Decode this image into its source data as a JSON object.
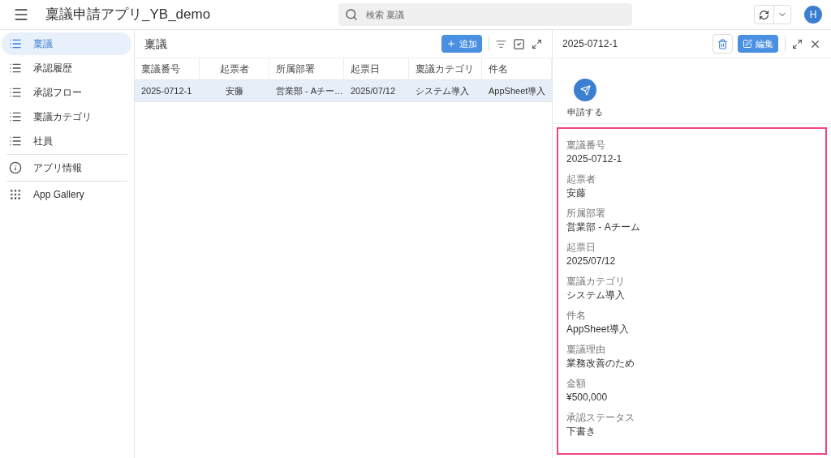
{
  "app_bar": {
    "title": "稟議申請アプリ_YB_demo",
    "search": {
      "placeholder": "検索 稟議"
    },
    "avatar": "H"
  },
  "sidebar": {
    "items": [
      {
        "label": "稟議",
        "kind": "list",
        "selected": true
      },
      {
        "label": "承認履歴",
        "kind": "list",
        "selected": false
      },
      {
        "label": "承認フロー",
        "kind": "list",
        "selected": false
      },
      {
        "label": "稟議カテゴリ",
        "kind": "list",
        "selected": false
      },
      {
        "label": "社員",
        "kind": "list",
        "selected": false
      },
      {
        "label": "アプリ情報",
        "kind": "info",
        "selected": false
      },
      {
        "label": "App Gallery",
        "kind": "grid",
        "selected": false
      }
    ]
  },
  "list_view": {
    "title": "稟議",
    "add_button": "追加",
    "table": {
      "columns": [
        "稟議番号",
        "起票者",
        "所属部署",
        "起票日",
        "稟議カテゴリ",
        "件名"
      ],
      "rows": [
        {
          "selected": true,
          "cells": [
            "2025-0712-1",
            "安藤",
            "営業部 - Aチー…",
            "2025/07/12",
            "システム導入",
            "AppSheet導入"
          ]
        }
      ]
    }
  },
  "detail": {
    "title": "2025-0712-1",
    "edit_button": "編集",
    "action": "申請する",
    "fields": [
      {
        "label": "稟議番号",
        "value": "2025-0712-1"
      },
      {
        "label": "起票者",
        "value": "安藤"
      },
      {
        "label": "所属部署",
        "value": "営業部 - Aチーム"
      },
      {
        "label": "起票日",
        "value": "2025/07/12"
      },
      {
        "label": "稟議カテゴリ",
        "value": "システム導入"
      },
      {
        "label": "件名",
        "value": "AppSheet導入"
      },
      {
        "label": "稟議理由",
        "value": "業務改善のため"
      },
      {
        "label": "金額",
        "value": "¥500,000"
      },
      {
        "label": "承認ステータス",
        "value": "下書き"
      }
    ]
  }
}
